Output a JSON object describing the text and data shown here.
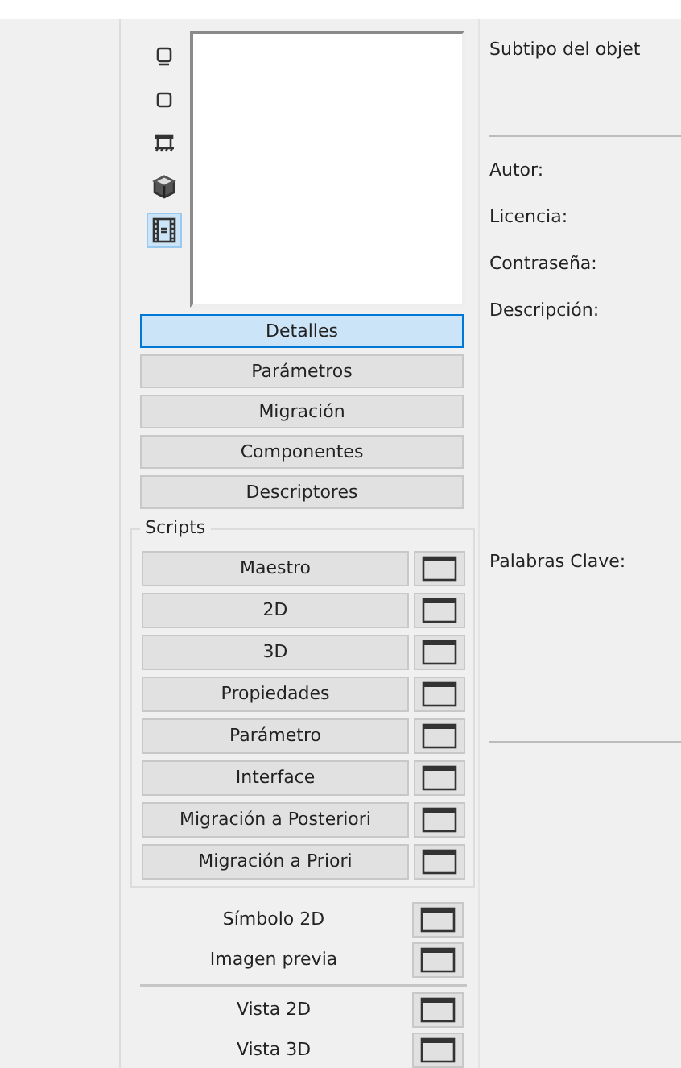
{
  "view_icons": [
    {
      "kind": "floor-plan",
      "selected": false
    },
    {
      "kind": "square",
      "selected": false
    },
    {
      "kind": "base",
      "selected": false
    },
    {
      "kind": "cube",
      "selected": false
    },
    {
      "kind": "film",
      "selected": true
    }
  ],
  "section_buttons": [
    {
      "label": "Detalles",
      "selected": true
    },
    {
      "label": "Parámetros",
      "selected": false
    },
    {
      "label": "Migración",
      "selected": false
    },
    {
      "label": "Componentes",
      "selected": false
    },
    {
      "label": "Descriptores",
      "selected": false
    }
  ],
  "scripts": {
    "title": "Scripts",
    "items": [
      {
        "label": "Maestro"
      },
      {
        "label": "2D"
      },
      {
        "label": "3D"
      },
      {
        "label": "Propiedades"
      },
      {
        "label": "Parámetro"
      },
      {
        "label": "Interface"
      },
      {
        "label": "Migración a Posteriori"
      },
      {
        "label": "Migración a Priori"
      }
    ]
  },
  "extras": [
    {
      "label": "Símbolo 2D"
    },
    {
      "label": "Imagen previa"
    }
  ],
  "views": [
    {
      "label": "Vista 2D"
    },
    {
      "label": "Vista 3D"
    }
  ],
  "details": {
    "subtype_label": "Subtipo del objet",
    "fields": [
      {
        "label": "Autor:"
      },
      {
        "label": "Licencia:"
      },
      {
        "label": "Contraseña:"
      },
      {
        "label": "Descripción:"
      }
    ],
    "keywords_label": "Palabras Clave:"
  }
}
